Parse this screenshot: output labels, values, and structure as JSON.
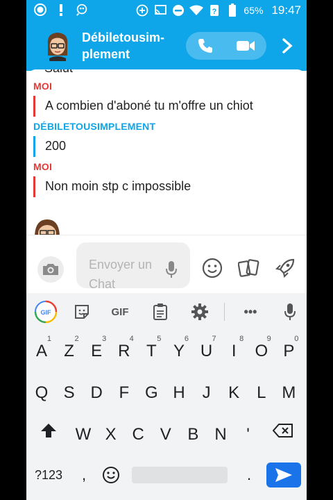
{
  "status_bar": {
    "battery": "65%",
    "time": "19:47"
  },
  "header": {
    "contact_name_line1": "Débiletousim-",
    "contact_name_line2": "plement"
  },
  "colors": {
    "accent": "#0ea5e9",
    "me": "#e53935",
    "friend": "#0ea5e9",
    "send": "#1a73e8"
  },
  "chat": {
    "cut_text": "Salut",
    "messages": [
      {
        "sender": "MOI",
        "text": "A combien d'aboné tu m'offre un chiot",
        "color": "#e53935"
      },
      {
        "sender": "DÉBILETOUSIMPLEMENT",
        "text": "200",
        "color": "#0ea5e9"
      },
      {
        "sender": "MOI",
        "text": "Non moin stp c impossible",
        "color": "#e53935"
      }
    ]
  },
  "input": {
    "placeholder_line1": "Envoyer un",
    "placeholder_line2": "Chat"
  },
  "keyboard": {
    "toolbar": [
      "gif-logo-icon",
      "sticker-icon",
      "GIF",
      "clipboard-icon",
      "gear-icon",
      "•••",
      "mic-icon"
    ],
    "gif_label": "GIF",
    "more_label": "•••",
    "row1": [
      "A",
      "Z",
      "E",
      "R",
      "T",
      "Y",
      "U",
      "I",
      "O",
      "P"
    ],
    "row1_hints": [
      "1",
      "2",
      "3",
      "4",
      "5",
      "6",
      "7",
      "8",
      "9",
      "0"
    ],
    "row2": [
      "Q",
      "S",
      "D",
      "F",
      "G",
      "H",
      "J",
      "K",
      "L",
      "M"
    ],
    "row3": [
      "W",
      "X",
      "C",
      "V",
      "B",
      "N",
      "'"
    ],
    "symbols_label": "?123",
    "comma": ",",
    "period": "."
  }
}
